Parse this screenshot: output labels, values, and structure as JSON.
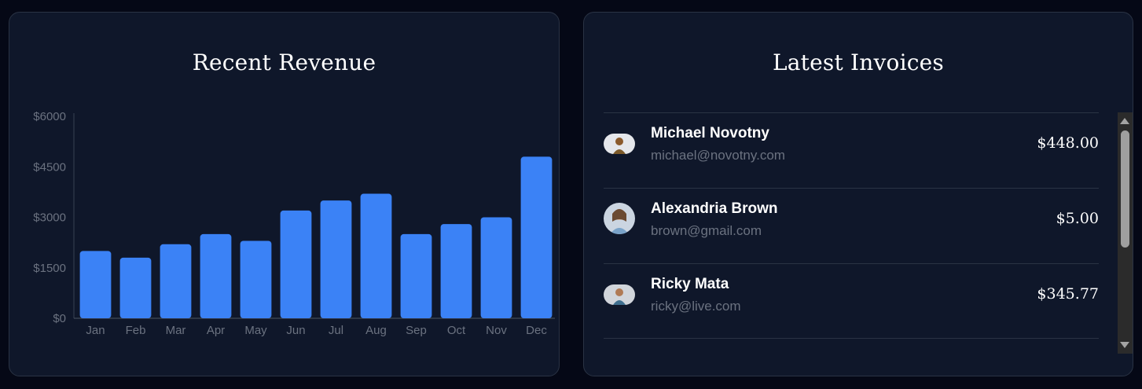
{
  "revenue": {
    "title": "Recent Revenue"
  },
  "chart_data": {
    "type": "bar",
    "title": "Recent Revenue",
    "xlabel": "",
    "ylabel": "",
    "categories": [
      "Jan",
      "Feb",
      "Mar",
      "Apr",
      "May",
      "Jun",
      "Jul",
      "Aug",
      "Sep",
      "Oct",
      "Nov",
      "Dec"
    ],
    "values": [
      2000,
      1800,
      2200,
      2500,
      2300,
      3200,
      3500,
      3700,
      2500,
      2800,
      3000,
      4800
    ],
    "ylim": [
      0,
      6000
    ],
    "yticks": [
      0,
      1500,
      3000,
      4500,
      6000
    ],
    "ytick_labels": [
      "$0",
      "$1500",
      "$3000",
      "$4500",
      "$6000"
    ],
    "bar_color": "#3b82f6",
    "grid": false,
    "legend": "none"
  },
  "invoices": {
    "title": "Latest Invoices",
    "items": [
      {
        "name": "Michael Novotny",
        "email": "michael@novotny.com",
        "amount": "$448.00",
        "avatar": "avatar-photo"
      },
      {
        "name": "Alexandria Brown",
        "email": "brown@gmail.com",
        "amount": "$5.00",
        "avatar": "avatar-photo"
      },
      {
        "name": "Ricky Mata",
        "email": "ricky@live.com",
        "amount": "$345.77",
        "avatar": "avatar-photo"
      }
    ]
  },
  "colors": {
    "page_bg": "#050816",
    "card_bg": "#0f172a",
    "accent": "#3b82f6",
    "muted_text": "#6b7280",
    "divider": "#2a3344"
  }
}
